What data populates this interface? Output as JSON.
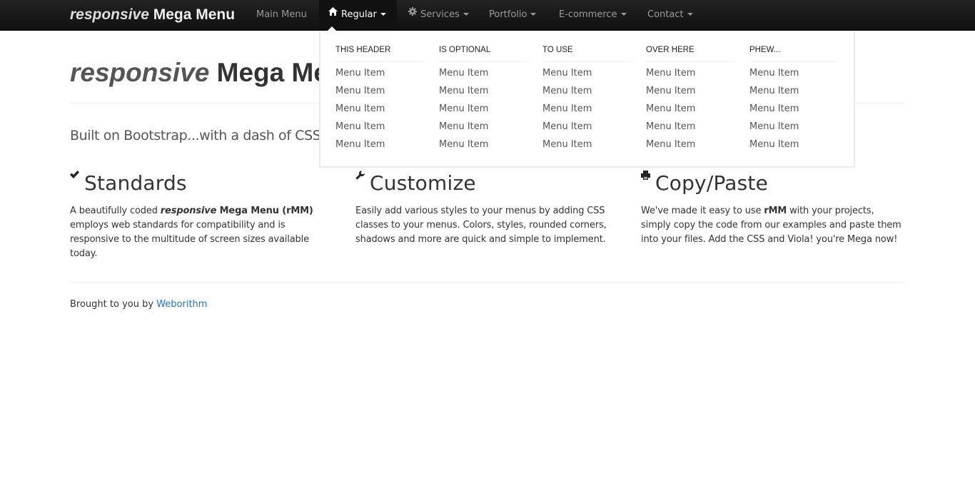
{
  "navbar": {
    "brand_italic": "responsive",
    "brand_rest": "Mega Menu",
    "items": [
      {
        "label": "Main Menu"
      },
      {
        "label": "Regular",
        "icon": "home-icon"
      },
      {
        "label": "Services",
        "icon": "cog-icon"
      },
      {
        "label": "Portfolio"
      },
      {
        "label": "E-commerce"
      },
      {
        "label": "Contact"
      }
    ]
  },
  "mega_menu": {
    "columns": [
      {
        "header": "THIS HEADER",
        "items": [
          "Menu Item",
          "Menu Item",
          "Menu Item",
          "Menu Item",
          "Menu Item"
        ]
      },
      {
        "header": "IS OPTIONAL",
        "items": [
          "Menu Item",
          "Menu Item",
          "Menu Item",
          "Menu Item",
          "Menu Item"
        ]
      },
      {
        "header": "TO USE",
        "items": [
          "Menu Item",
          "Menu Item",
          "Menu Item",
          "Menu Item",
          "Menu Item"
        ]
      },
      {
        "header": "OVER HERE",
        "items": [
          "Menu Item",
          "Menu Item",
          "Menu Item",
          "Menu Item",
          "Menu Item"
        ]
      },
      {
        "header": "PHEW...",
        "items": [
          "Menu Item",
          "Menu Item",
          "Menu Item",
          "Menu Item",
          "Menu Item"
        ]
      }
    ]
  },
  "hero": {
    "title_italic": "responsive",
    "title_rest": "Mega Menu",
    "lead": "Built on Bootstrap...with a dash of CSS"
  },
  "features": [
    {
      "icon": "checkmark-icon",
      "title": "Standards",
      "text_before": "A beautifully coded ",
      "text_italic_bold": "responsive",
      "text_bold": " Mega Menu (rMM)",
      "text_after": " employs web standards for compatibility and is responsive to the multitude of screen sizes available today."
    },
    {
      "icon": "wrench-icon",
      "title": "Customize",
      "text": "Easily add various styles to your menus by adding CSS classes to your menus. Colors, styles, rounded corners, shadows and more are quick and simple to implement."
    },
    {
      "icon": "printer-icon",
      "title": "Copy/Paste",
      "text_before": "We've made it easy to use ",
      "text_bold": "rMM",
      "text_after": " with your projects, simply copy the code from our examples and paste them into your files. Add the CSS and Viola! you're Mega now!"
    }
  ],
  "footer": {
    "credit_text": "Brought to you by",
    "credit_link": "Weborithm"
  },
  "colors": {
    "navbar_bg": "#1b1b1b",
    "nav_text": "#999999",
    "nav_active_text": "#ffffff",
    "link": "#2a6fb3"
  }
}
